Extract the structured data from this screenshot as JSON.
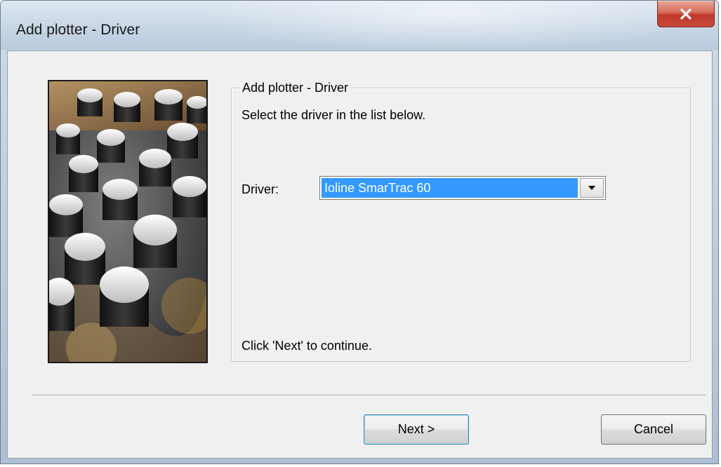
{
  "window": {
    "title": "Add plotter - Driver",
    "close_icon": "close-x-icon"
  },
  "groupbox": {
    "title": "Add plotter - Driver",
    "instruction": "Select the driver in the list below.",
    "hint": "Click 'Next' to continue."
  },
  "driver": {
    "label": "Driver:",
    "selected_value": "Ioline SmarTrac 60",
    "dropdown_icon": "chevron-down-icon"
  },
  "buttons": {
    "next_label": "Next >",
    "cancel_label": "Cancel"
  },
  "colors": {
    "selection": "#3399ff",
    "close_button": "#c7493a",
    "dialog_background": "#f0f0f0"
  }
}
